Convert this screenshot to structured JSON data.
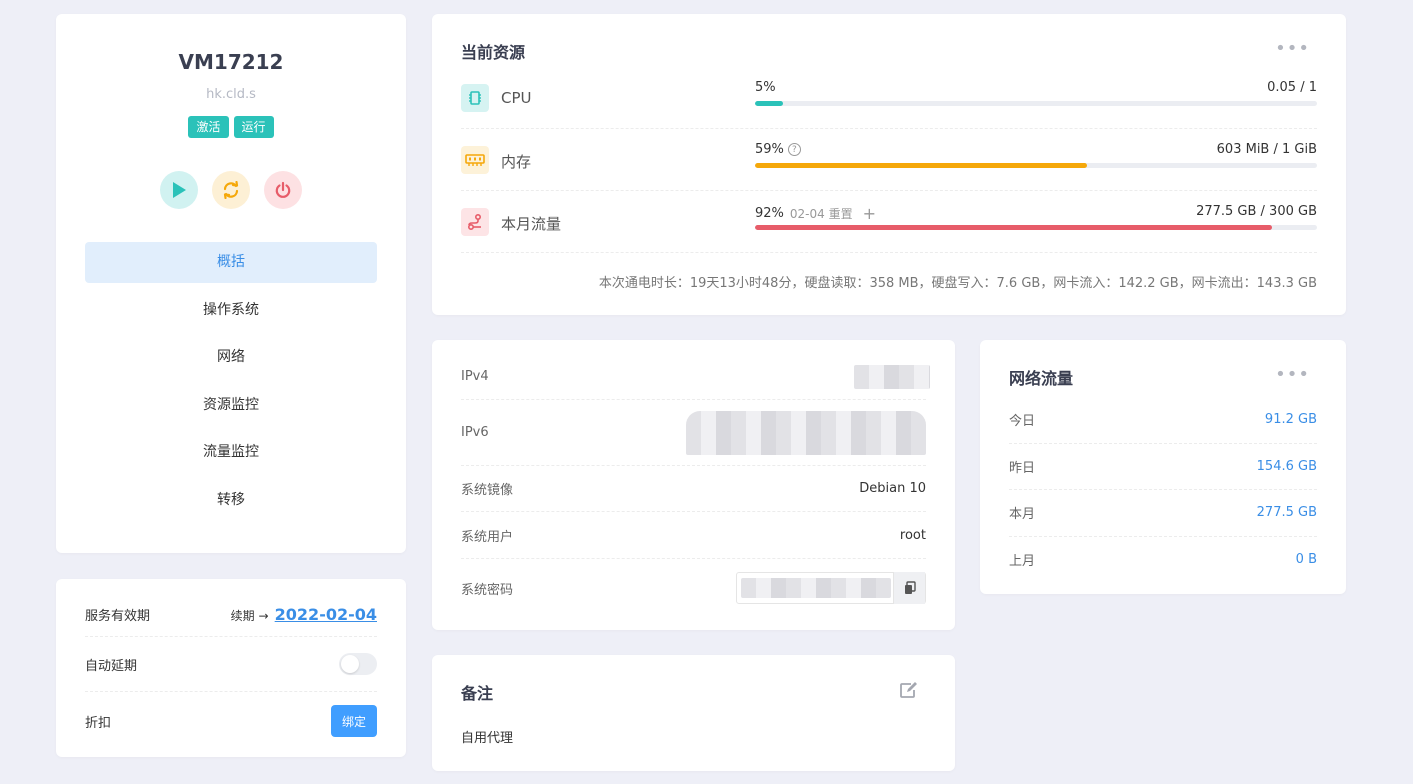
{
  "vm": {
    "name": "VM17212",
    "host": "hk.cld.s",
    "badges": [
      "激活",
      "运行"
    ]
  },
  "power": {
    "start_icon": "play-icon",
    "restart_icon": "restart-icon",
    "stop_icon": "power-icon"
  },
  "menu": {
    "items": [
      {
        "label": "概括",
        "active": true
      },
      {
        "label": "操作系统"
      },
      {
        "label": "网络"
      },
      {
        "label": "资源监控"
      },
      {
        "label": "流量监控"
      },
      {
        "label": "转移"
      }
    ]
  },
  "service": {
    "expiry_label": "服务有效期",
    "renew_label": "续期 →",
    "expiry_date": "2022-02-04",
    "auto_renew_label": "自动延期",
    "auto_renew": false,
    "discount_label": "折扣",
    "bind_label": "绑定"
  },
  "resources": {
    "title": "当前资源",
    "cpu": {
      "label": "CPU",
      "percent_text": "5%",
      "percent": 5,
      "value": "0.05 / 1",
      "color": "#2bc2b9"
    },
    "memory": {
      "label": "内存",
      "percent_text": "59%",
      "percent": 59,
      "value": "603 MiB / 1 GiB",
      "color": "#f5a80a"
    },
    "traffic": {
      "label": "本月流量",
      "percent_text": "92%",
      "percent": 92,
      "reset_note": "02-04 重置",
      "value": "277.5 GB / 300 GB",
      "color": "#e75c69"
    },
    "uptime_text": "本次通电时长：19天13小时48分，硬盘读取：358 MB，硬盘写入：7.6 GB，网卡流入：142.2 GB，网卡流出：143.3 GB"
  },
  "info": {
    "ipv4_label": "IPv4",
    "ipv6_label": "IPv6",
    "image_label": "系统镜像",
    "image_value": "Debian 10",
    "user_label": "系统用户",
    "user_value": "root",
    "password_label": "系统密码"
  },
  "traffic": {
    "title": "网络流量",
    "rows": [
      {
        "label": "今日",
        "value": "91.2 GB"
      },
      {
        "label": "昨日",
        "value": "154.6 GB"
      },
      {
        "label": "本月",
        "value": "277.5 GB"
      },
      {
        "label": "上月",
        "value": "0 B"
      }
    ]
  },
  "note": {
    "title": "备注",
    "text": "自用代理"
  }
}
